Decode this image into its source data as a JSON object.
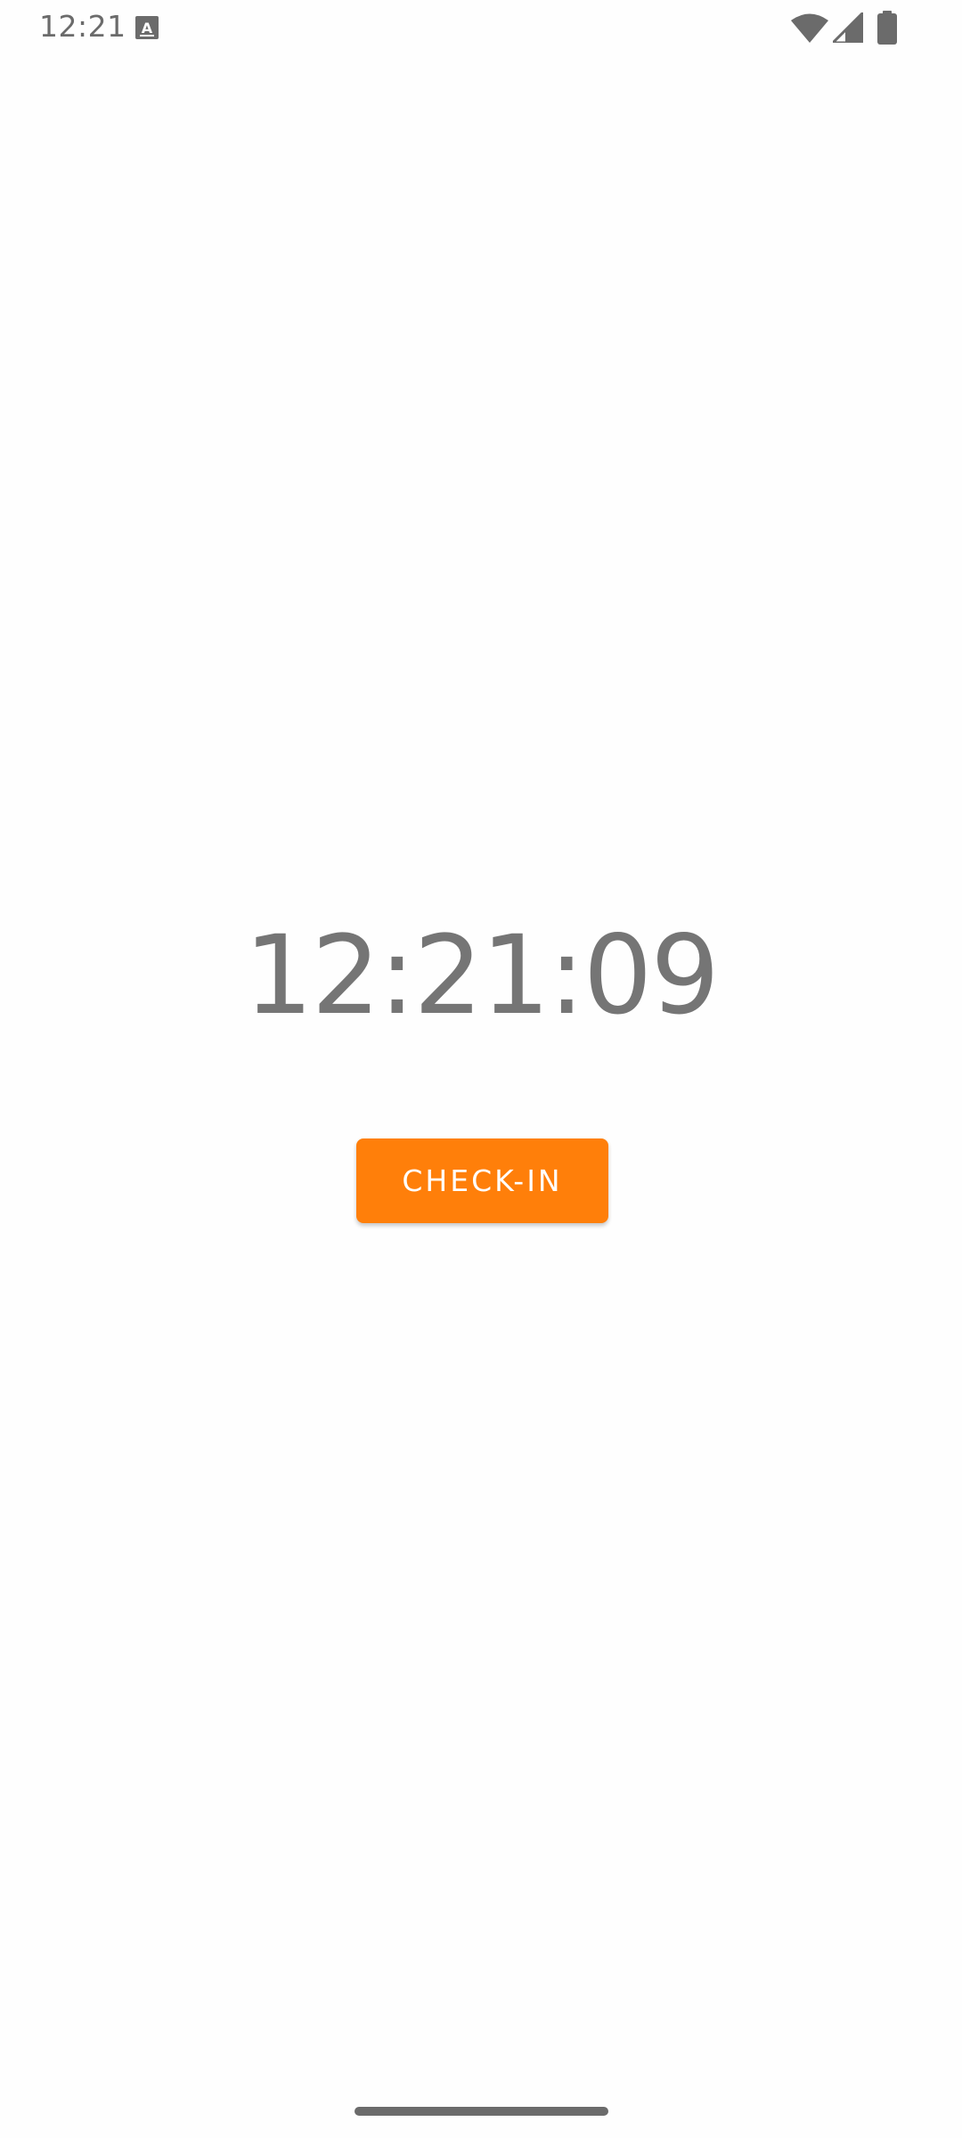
{
  "status_bar": {
    "time": "12:21",
    "icons": [
      "text-notification-icon",
      "wifi-icon",
      "cell-signal-icon",
      "battery-icon"
    ],
    "icon_color": "#6b6b6b"
  },
  "main": {
    "clock_time": "12:21:09",
    "clock_color": "#757575",
    "checkin_label": "CHECK-IN",
    "checkin_color": "#ff7f0a"
  }
}
